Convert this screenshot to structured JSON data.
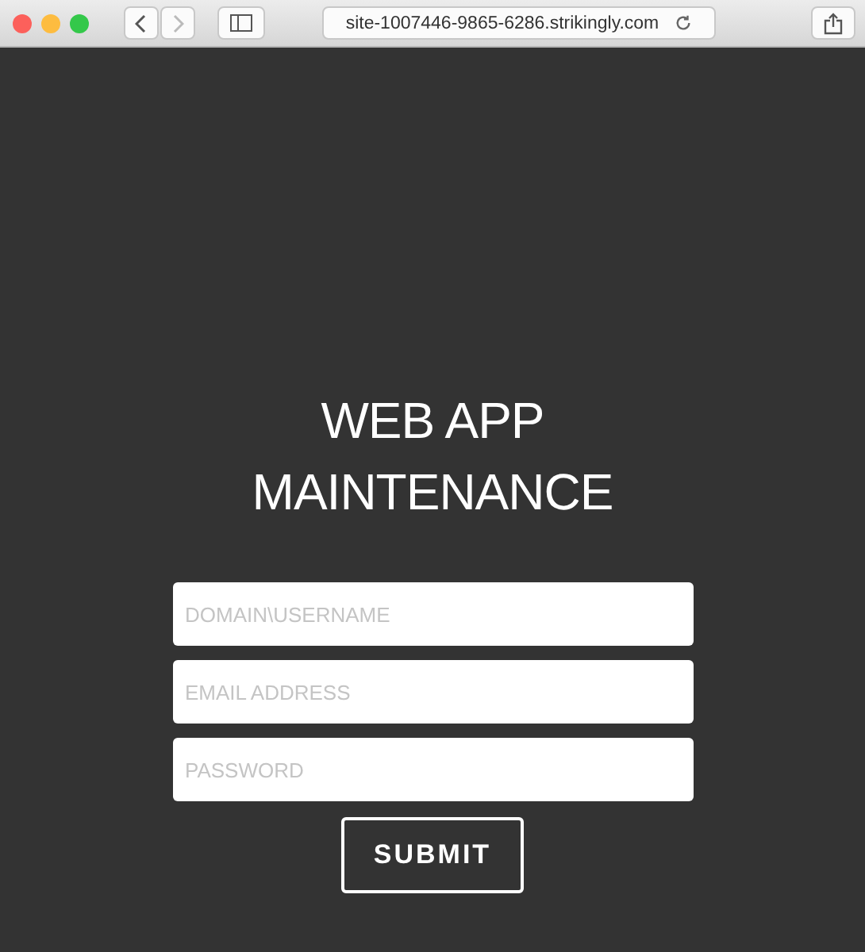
{
  "browser": {
    "url": "site-1007446-9865-6286.strikingly.com",
    "back_disabled": false,
    "forward_disabled": true
  },
  "title_lines": [
    "WEB APP",
    "MAINTENANCE"
  ],
  "fields": [
    {
      "placeholder": "DOMAIN\\USERNAME"
    },
    {
      "placeholder": "EMAIL ADDRESS"
    },
    {
      "placeholder": "PASSWORD"
    }
  ],
  "submit": "SUBMIT"
}
